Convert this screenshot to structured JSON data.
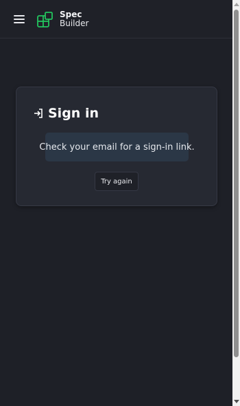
{
  "header": {
    "menu_icon": "hamburger-menu-icon",
    "logo_icon": "spec-builder-logo-icon",
    "brand_line1": "Spec",
    "brand_line2": "Builder"
  },
  "card": {
    "title_icon": "sign-in-arrow-icon",
    "title": "Sign in",
    "message": "Check your email for a sign-in link.",
    "retry_label": "Try again"
  },
  "colors": {
    "background": "#1e2027",
    "card": "#262932",
    "alert": "#2b3746",
    "brand_accent": "#22c55e"
  }
}
